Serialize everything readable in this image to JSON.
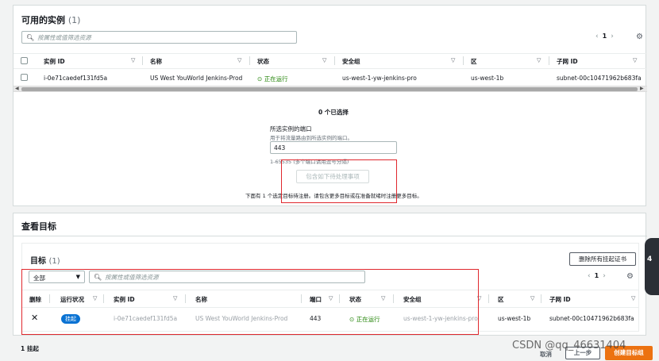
{
  "available": {
    "title": "可用的实例",
    "count": "(1)",
    "search_placeholder": "按属性或值筛选资源",
    "page": "1",
    "columns": [
      "实例 ID",
      "名称",
      "状态",
      "安全组",
      "区",
      "子网 ID"
    ],
    "row": {
      "instance_id": "i-0e71caedef131fd5a",
      "name": "US West YouWorld Jenkins-Prod",
      "status": "正在运行",
      "security_group": "us-west-1-yw-jenkins-pro",
      "zone": "us-west-1b",
      "subnet": "subnet-00c10471962b683fa"
    },
    "selected_label": "0 个已选择",
    "port_label": "所选实例的端口",
    "port_hint": "用于将流量路由到所选实例的端口。",
    "port_value": "443",
    "port_range": "1-65535 (多个端口请用逗号分隔)",
    "include_button": "包含如下待处理事项",
    "note": "下面有 1 个选定目标待注册。请包含更多目标或在准备就绪时注册更多目标。"
  },
  "review": {
    "title": "查看目标",
    "targets_title": "目标",
    "targets_count": "(1)",
    "remove_all_button": "删除所有挂起证书",
    "filter_value": "全部",
    "search_placeholder": "按属性或值筛选资源",
    "page": "1",
    "columns": [
      "删除",
      "运行状况",
      "实例 ID",
      "名称",
      "端口",
      "状态",
      "安全组",
      "区",
      "子网 ID"
    ],
    "row": {
      "health": "挂起",
      "instance_id": "i-0e71caedef131fd5a",
      "name": "US West YouWorld Jenkins-Prod",
      "port": "443",
      "status": "正在运行",
      "security_group": "us-west-1-yw-jenkins-pro",
      "zone": "us-west-1b",
      "subnet": "subnet-00c10471962b683fa"
    }
  },
  "footer": {
    "pending": "1 挂起",
    "cancel": "取消",
    "prev": "上一步",
    "create": "创建目标组",
    "watermark": "CSDN @qq_46631404"
  },
  "colors": {
    "accent": "#ec7211",
    "running": "#1d8102",
    "highlight": "#e0282e",
    "badge": "#0972d3"
  }
}
